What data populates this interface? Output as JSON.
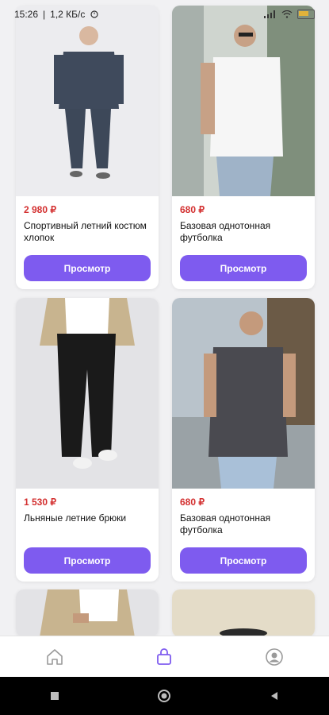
{
  "status_bar": {
    "time": "15:26",
    "network_speed": "1,2 КБ/с",
    "battery_icon": "battery-icon",
    "wifi_icon": "wifi-icon",
    "signal_icon": "signal-icon"
  },
  "products": [
    {
      "price": "2 980 ₽",
      "title": "Спортивный летний костюм хлопок",
      "button": "Просмотр",
      "photo_icon": "product-photo"
    },
    {
      "price": "680 ₽",
      "title": "Базовая однотонная футболка",
      "button": "Просмотр",
      "photo_icon": "product-photo"
    },
    {
      "price": "1 530 ₽",
      "title": "Льняные летние брюки",
      "button": "Просмотр",
      "photo_icon": "product-photo"
    },
    {
      "price": "680 ₽",
      "title": "Базовая однотонная футболка",
      "button": "Просмотр",
      "photo_icon": "product-photo"
    }
  ],
  "bottom_nav": {
    "items": [
      {
        "icon": "home-icon",
        "active": false
      },
      {
        "icon": "shopping-bag-icon",
        "active": true
      },
      {
        "icon": "profile-icon",
        "active": false
      }
    ]
  },
  "colors": {
    "accent": "#7e5bef",
    "price": "#d32f2f",
    "background": "#f1f1f3"
  }
}
